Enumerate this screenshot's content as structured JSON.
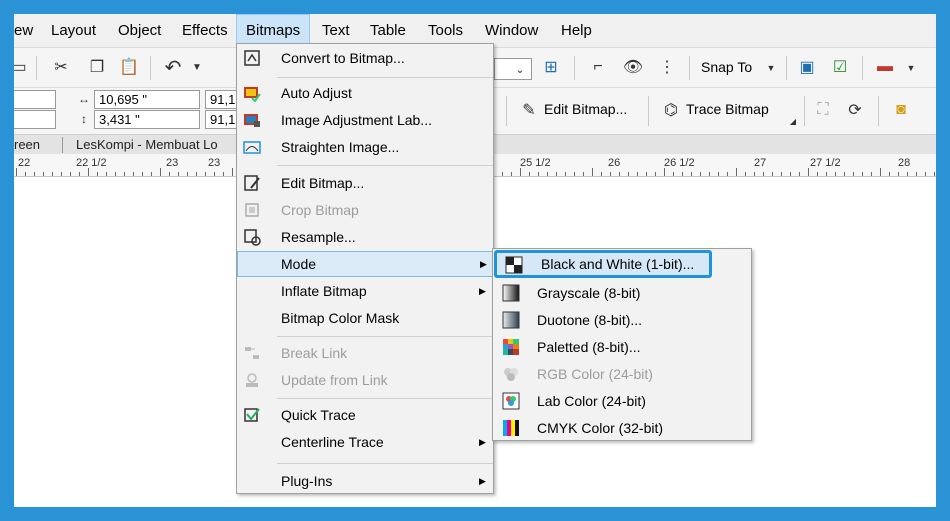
{
  "menubar": {
    "items": [
      "ew",
      "Layout",
      "Object",
      "Effects",
      "Bitmaps",
      "Text",
      "Table",
      "Tools",
      "Window",
      "Help"
    ],
    "active": "Bitmaps"
  },
  "toolbar": {
    "snap_to": "Snap To",
    "size_w": "10,695 \"",
    "size_h": "3,431 \"",
    "scale_w": "91,1",
    "scale_h": "91,1",
    "edit_bitmap": "Edit Bitmap...",
    "trace_bitmap": "Trace Bitmap"
  },
  "tabs": [
    "reen",
    "LesKompi - Membuat Lo"
  ],
  "ruler": [
    "22",
    "22 1/2",
    "23",
    "23",
    "25 1/2",
    "26",
    "26 1/2",
    "27",
    "27 1/2",
    "28"
  ],
  "bitmaps_menu": {
    "items": [
      {
        "label": "Convert to Bitmap...",
        "icon": "convert-bitmap-icon",
        "disabled": false
      },
      {
        "label": "Auto Adjust",
        "icon": "auto-adjust-icon",
        "disabled": false
      },
      {
        "label": "Image Adjustment Lab...",
        "icon": "image-adjustment-lab-icon",
        "disabled": false
      },
      {
        "label": "Straighten Image...",
        "icon": "straighten-image-icon",
        "disabled": false
      },
      {
        "label": "Edit Bitmap...",
        "icon": "edit-bitmap-icon",
        "disabled": false
      },
      {
        "label": "Crop Bitmap",
        "icon": "crop-bitmap-icon",
        "disabled": true
      },
      {
        "label": "Resample...",
        "icon": "resample-icon",
        "disabled": false
      },
      {
        "label": "Mode",
        "icon": "",
        "disabled": false,
        "submenu": true
      },
      {
        "label": "Inflate Bitmap",
        "icon": "",
        "disabled": false,
        "submenu": true
      },
      {
        "label": "Bitmap Color Mask",
        "icon": "",
        "disabled": false
      },
      {
        "label": "Break Link",
        "icon": "break-link-icon",
        "disabled": true
      },
      {
        "label": "Update from Link",
        "icon": "update-link-icon",
        "disabled": true
      },
      {
        "label": "Quick Trace",
        "icon": "quick-trace-icon",
        "disabled": false
      },
      {
        "label": "Centerline Trace",
        "icon": "",
        "disabled": false,
        "submenu": true
      },
      {
        "label": "Plug-Ins",
        "icon": "",
        "disabled": false,
        "submenu": true
      }
    ]
  },
  "mode_submenu": {
    "items": [
      {
        "label": "Black and White (1-bit)...",
        "icon": "black-white-icon",
        "disabled": false
      },
      {
        "label": "Grayscale (8-bit)",
        "icon": "grayscale-icon",
        "disabled": false
      },
      {
        "label": "Duotone (8-bit)...",
        "icon": "duotone-icon",
        "disabled": false
      },
      {
        "label": "Paletted (8-bit)...",
        "icon": "paletted-icon",
        "disabled": false
      },
      {
        "label": "RGB Color (24-bit)",
        "icon": "rgb-color-icon",
        "disabled": true
      },
      {
        "label": "Lab Color (24-bit)",
        "icon": "lab-color-icon",
        "disabled": false
      },
      {
        "label": "CMYK Color (32-bit)",
        "icon": "cmyk-color-icon",
        "disabled": false
      }
    ]
  },
  "colors": {
    "frame": "#2a93d5",
    "highlight": "#1f93dc",
    "pointer": "#2a93d5"
  }
}
